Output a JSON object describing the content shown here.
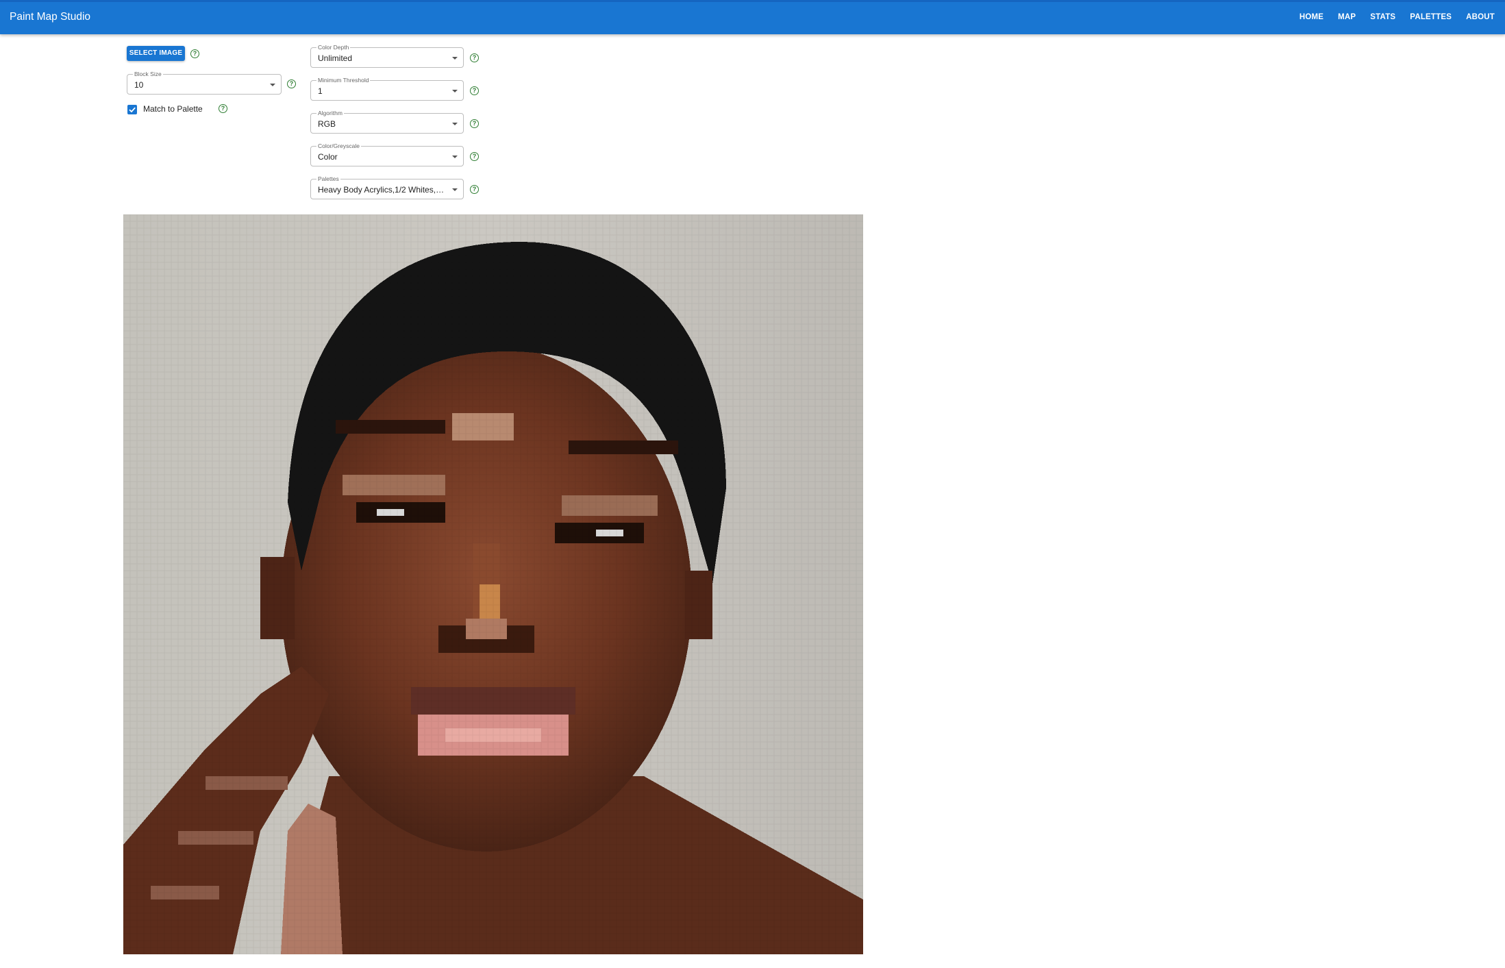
{
  "app": {
    "title": "Paint Map Studio"
  },
  "nav": {
    "items": [
      {
        "label": "HOME"
      },
      {
        "label": "MAP"
      },
      {
        "label": "STATS"
      },
      {
        "label": "PALETTES"
      },
      {
        "label": "ABOUT"
      }
    ]
  },
  "controls": {
    "select_image_label": "SELECT IMAGE",
    "block_size": {
      "label": "Block Size",
      "value": "10"
    },
    "match_to_palette": {
      "label": "Match to Palette",
      "checked": true
    },
    "color_depth": {
      "label": "Color Depth",
      "value": "Unlimited"
    },
    "minimum_threshold": {
      "label": "Minimum Threshold",
      "value": "1"
    },
    "algorithm": {
      "label": "Algorithm",
      "value": "RGB"
    },
    "color_greyscale": {
      "label": "Color/Greyscale",
      "value": "Color"
    },
    "palettes": {
      "label": "Palettes",
      "value": "Heavy Body Acrylics,1/2 Whites,1..."
    }
  },
  "help_icon_glyph": "?",
  "colors": {
    "appbar": "#1976d2",
    "help_icon": "#2e7d32",
    "checkbox": "#1976d2"
  }
}
